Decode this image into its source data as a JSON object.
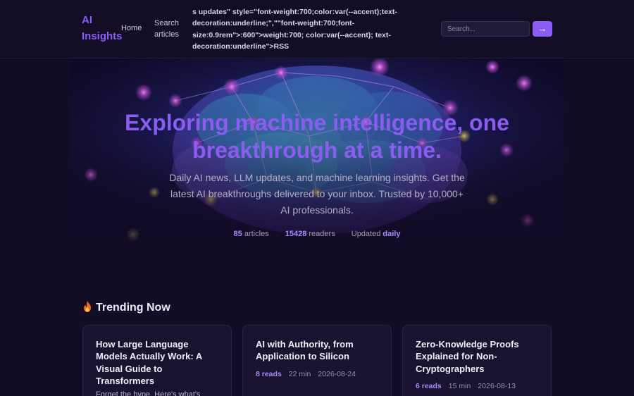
{
  "nav": {
    "logo": "AI Insights",
    "home": "Home",
    "search_articles": "Search articles",
    "raw_link_text": "s updates\" style=\"font-weight:700;color:var(--accent);text-decoration:underline;\",\"\"font-weight:700;font-size:0.9rem\">:600\">weight:700; color:var(--accent); text-decoration:underline\">RSS",
    "search_placeholder": "Search...",
    "search_button": "→"
  },
  "hero": {
    "title": "Exploring machine intelligence, one breakthrough at a time.",
    "subtitle": "Daily AI news, LLM updates, and machine learning insights. Get the latest AI breakthroughs delivered to your inbox. Trusted by 10,000+ AI professionals.",
    "stats": {
      "articles_value": "85",
      "articles_label": "articles",
      "readers_value": "15428",
      "readers_label": "readers",
      "updated_label": "Updated",
      "updated_value": "daily"
    }
  },
  "trending": {
    "title": "Trending Now",
    "icon": "flame-icon",
    "cards": [
      {
        "title": "How Large Language Models Actually Work: A Visual Guide to Transformers",
        "excerpt": "Forget the hype. Here's what's"
      },
      {
        "title": "AI with Authority, from Application to Silicon",
        "reads": "8 reads",
        "minutes": "22 min",
        "date": "2026-08-24"
      },
      {
        "title": "Zero-Knowledge Proofs Explained for Non-Cryptographers",
        "reads": "6 reads",
        "minutes": "15 min",
        "date": "2026-08-13"
      }
    ]
  },
  "colors": {
    "accent": "#8b5cf6",
    "background": "#120c24",
    "card": "#1a1330"
  }
}
